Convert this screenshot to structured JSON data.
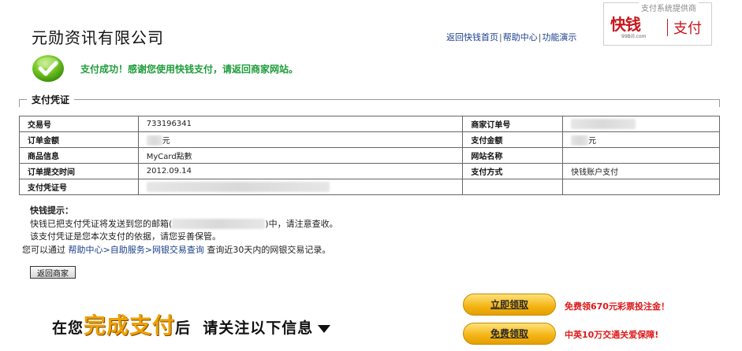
{
  "header": {
    "company_name": "元勋资讯有限公司",
    "links": [
      "返回快钱首页",
      "帮助中心",
      "功能演示"
    ],
    "link_separator": "|",
    "provider_caption": "支付系统提供商",
    "provider_logo_text": "快钱",
    "provider_logo_small": "99Bill.com",
    "provider_pay_text": "支付"
  },
  "status": {
    "message": "支付成功！感谢您使用快钱支付，请返回商家网站。",
    "color": "#1f9c3a"
  },
  "voucher": {
    "section_title": "支付凭证",
    "rows": [
      {
        "l1": "交易号",
        "v1": "733196341",
        "l2": "商家订单号",
        "v2": ""
      },
      {
        "l1": "订单金额",
        "v1": "元",
        "l2": "支付金额",
        "v2": "元"
      },
      {
        "l1": "商品信息",
        "v1": "MyCard點數",
        "l2": "网站名称",
        "v2": ""
      },
      {
        "l1": "订单提交时间",
        "v1": "2012.09.14",
        "l2": "支付方式",
        "v2": "快钱账户支付"
      },
      {
        "l1": "支付凭证号",
        "v1": "",
        "l2": "",
        "v2": ""
      }
    ]
  },
  "tips": {
    "title": "快钱提示：",
    "line1_prefix": "快钱已把支付凭证将发送到您的邮箱(",
    "line1_suffix": ")中，请注意查收。",
    "line2": "该支付凭证是您本次支付的依据，请您妥善保管。",
    "line3_prefix": "您可以通过 ",
    "link_help": "帮助中心",
    "link_self": "自助服务",
    "link_query": "网银交易查询",
    "arrow": ">",
    "line3_suffix": " 查询近30天内的网银交易记录。"
  },
  "back_button_label": "返回商家",
  "banner": {
    "pre": "在您",
    "highlight": "完成支付",
    "post": "后  请关注以下信息"
  },
  "promos": [
    {
      "button": "立即领取",
      "text": "免费领670元彩票投注金！"
    },
    {
      "button": "免费领取",
      "text": "中英10万交通关爱保障!"
    }
  ],
  "colors": {
    "accent_red": "#c8161d",
    "link_blue": "#1a3e8c",
    "promo_gold": "#f3b313"
  }
}
